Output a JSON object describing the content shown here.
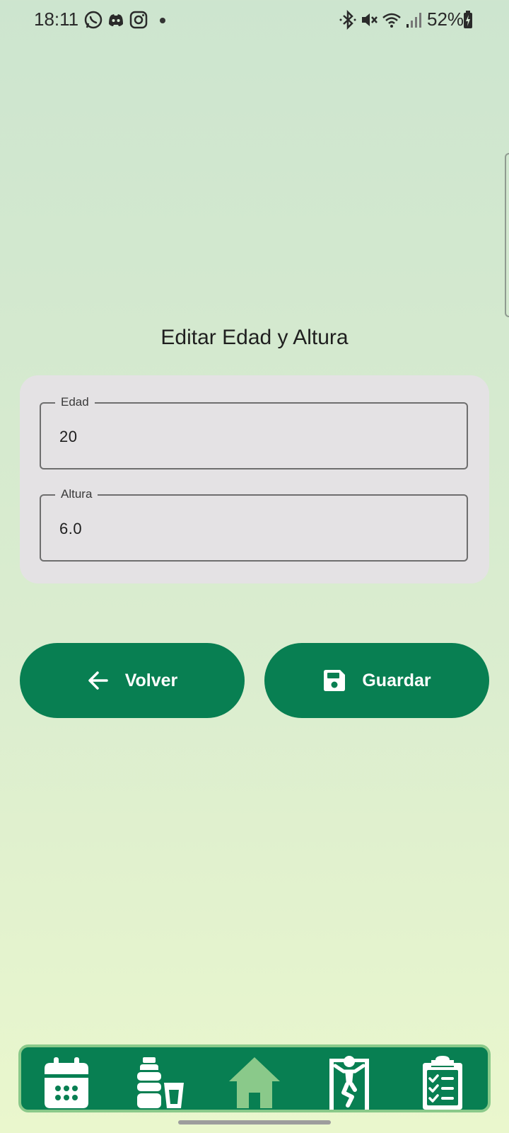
{
  "status_bar": {
    "time": "18:11",
    "battery": "52%",
    "icons_left": [
      "whatsapp-icon",
      "discord-icon",
      "instagram-icon"
    ],
    "icons_right": [
      "bluetooth-icon",
      "mute-icon",
      "wifi-icon",
      "signal-icon",
      "battery-icon"
    ]
  },
  "page": {
    "title": "Editar Edad y Altura"
  },
  "form": {
    "age": {
      "label": "Edad",
      "value": "20"
    },
    "height": {
      "label": "Altura",
      "value": "6.0"
    }
  },
  "buttons": {
    "back": {
      "label": "Volver",
      "icon": "arrow-left-icon"
    },
    "save": {
      "label": "Guardar",
      "icon": "floppy-disk-icon"
    }
  },
  "bottom_nav": {
    "items": [
      {
        "name": "calendar",
        "icon": "calendar-icon",
        "active": false
      },
      {
        "name": "hydration",
        "icon": "bottle-glass-icon",
        "active": false
      },
      {
        "name": "home",
        "icon": "home-icon",
        "active": true
      },
      {
        "name": "exercise",
        "icon": "pullup-icon",
        "active": false
      },
      {
        "name": "checklist",
        "icon": "clipboard-checklist-icon",
        "active": false
      }
    ]
  },
  "colors": {
    "primary": "#087f52",
    "active_nav": "#8ac98a",
    "card": "#e4e2e4"
  }
}
